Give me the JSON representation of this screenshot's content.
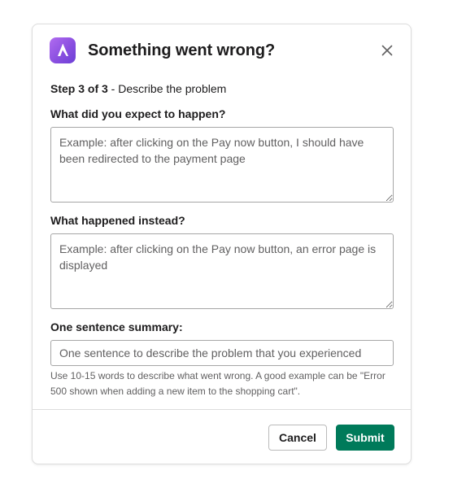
{
  "dialog": {
    "title": "Something went wrong?",
    "close_label": "×"
  },
  "step": {
    "counter": "Step 3 of 3",
    "separator": " - ",
    "description": "Describe the problem"
  },
  "fields": {
    "expected": {
      "label": "What did you expect to happen?",
      "value": "",
      "placeholder": "Example: after clicking on the Pay now button, I should have been redirected to the payment page"
    },
    "actual": {
      "label": "What happened instead?",
      "value": "",
      "placeholder": "Example: after clicking on the Pay now button, an error page is displayed"
    },
    "summary": {
      "label": "One sentence summary:",
      "value": "",
      "placeholder": "One sentence to describe the problem that you experienced",
      "hint": "Use 10-15 words to describe what went wrong. A good example can be \"Error 500 shown when adding a new item to the shopping cart\"."
    }
  },
  "footer": {
    "cancel_label": "Cancel",
    "submit_label": "Submit"
  },
  "colors": {
    "logo_gradient_start": "#b16cf0",
    "logo_gradient_end": "#6c3fd6",
    "submit_bg": "#007a5a",
    "text": "#1d1c1d",
    "muted_text": "#616061",
    "border": "#a6a6a6"
  },
  "icons": {
    "logo": "app-logo-icon",
    "close": "close-icon",
    "resize": "resize-handle-icon"
  }
}
